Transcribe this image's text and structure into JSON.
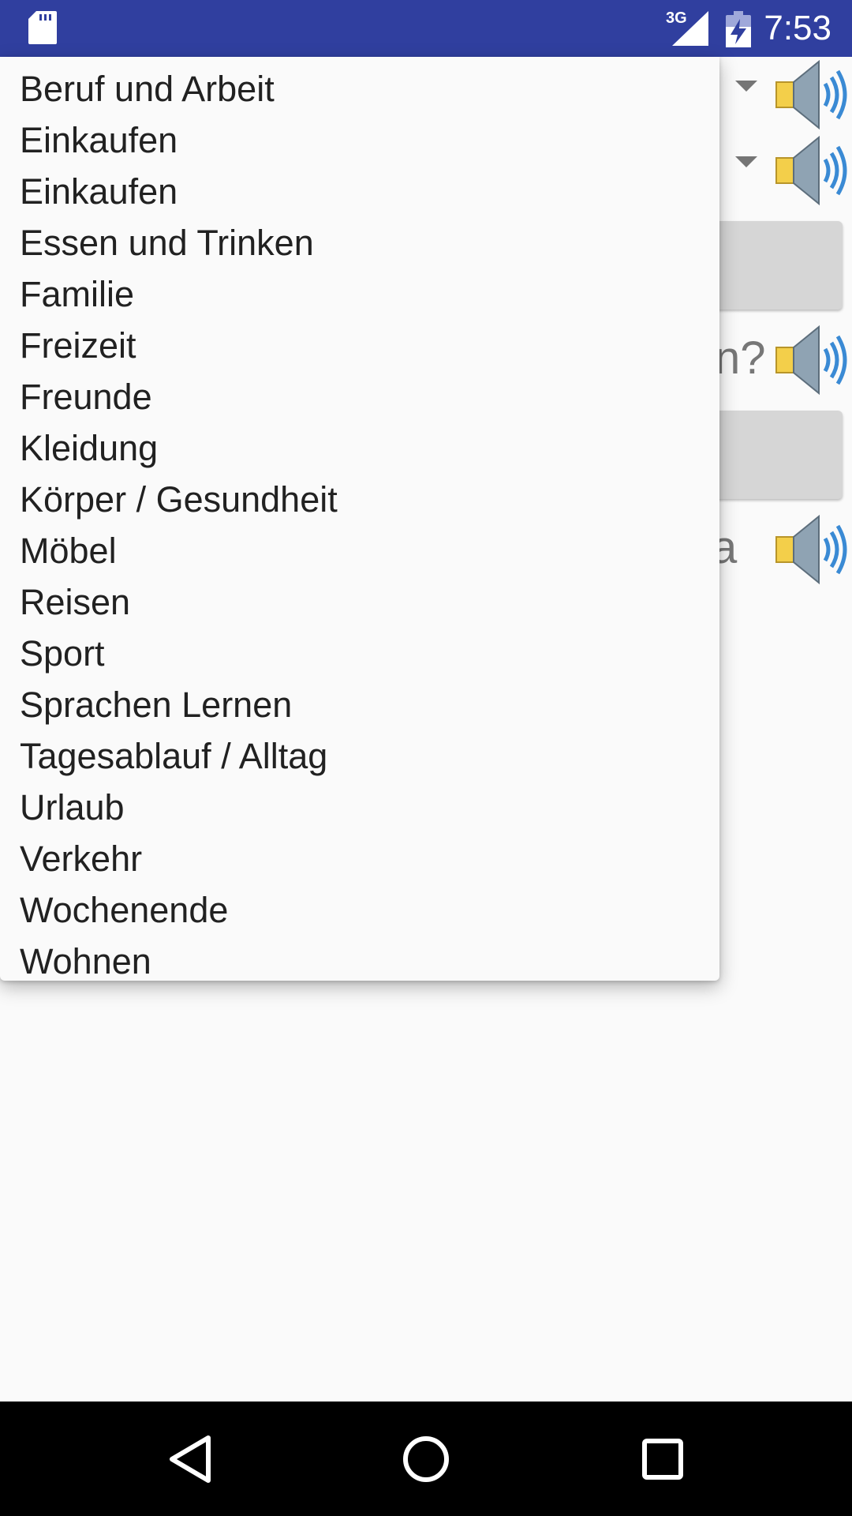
{
  "status_bar": {
    "network": "3G",
    "time": "7:53",
    "icons": [
      "sd-card-icon",
      "cell-signal-icon",
      "battery-charging-icon"
    ],
    "background": "#303f9f"
  },
  "background": {
    "question_fragment": "n?",
    "answer_fragment": "a"
  },
  "dropdown": {
    "items": [
      "Beruf und Arbeit",
      "Einkaufen",
      "Einkaufen",
      "Essen und Trinken",
      "Familie",
      "Freizeit",
      "Freunde",
      "Kleidung",
      "Körper / Gesundheit",
      "Möbel",
      "Reisen",
      "Sport",
      "Sprachen Lernen",
      "Tagesablauf / Alltag",
      "Urlaub",
      "Verkehr",
      "Wochenende",
      "Wohnen"
    ]
  },
  "nav_bar": {
    "buttons": [
      "back-icon",
      "home-icon",
      "recents-icon"
    ]
  }
}
